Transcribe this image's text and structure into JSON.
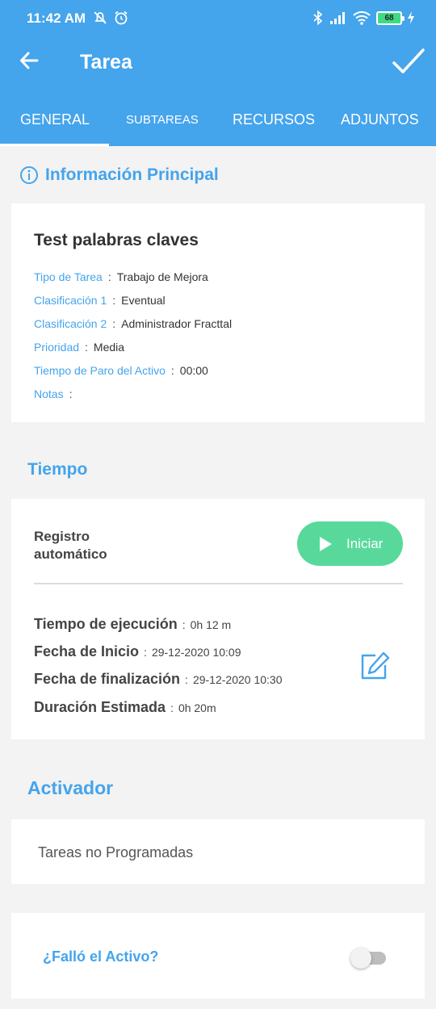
{
  "status_bar": {
    "time": "11:42 AM",
    "battery": "68"
  },
  "header": {
    "title": "Tarea"
  },
  "tabs": [
    {
      "label": "GENERAL"
    },
    {
      "label": "SUBTAREAS"
    },
    {
      "label": "RECURSOS"
    },
    {
      "label": "ADJUNTOS"
    }
  ],
  "info": {
    "section_title": "Información Principal",
    "task_title": "Test palabras claves",
    "fields": [
      {
        "label": "Tipo de Tarea",
        "value": "Trabajo de Mejora"
      },
      {
        "label": "Clasificación 1",
        "value": "Eventual"
      },
      {
        "label": "Clasificación 2",
        "value": "Administrador Fracttal"
      },
      {
        "label": "Prioridad",
        "value": "Media"
      },
      {
        "label": "Tiempo de Paro del Activo",
        "value": "00:00"
      },
      {
        "label": "Notas",
        "value": ""
      }
    ],
    "separator": ":"
  },
  "tiempo": {
    "section_title": "Tiempo",
    "auto_label_line1": "Registro",
    "auto_label_line2": "automático",
    "start_button": "Iniciar",
    "fields": [
      {
        "label": "Tiempo de ejecución",
        "value": "0h 12 m"
      },
      {
        "label": "Fecha de Inicio",
        "value": "29-12-2020 10:09"
      },
      {
        "label": "Fecha de finalización",
        "value": "29-12-2020 10:30"
      },
      {
        "label": "Duración Estimada",
        "value": "0h 20m"
      }
    ]
  },
  "activador": {
    "section_title": "Activador",
    "value": "Tareas no Programadas"
  },
  "fallo": {
    "question": "¿Falló el Activo?",
    "toggle_on": false
  },
  "colors": {
    "primary": "#44a4ec",
    "start_button": "#58d99b"
  }
}
